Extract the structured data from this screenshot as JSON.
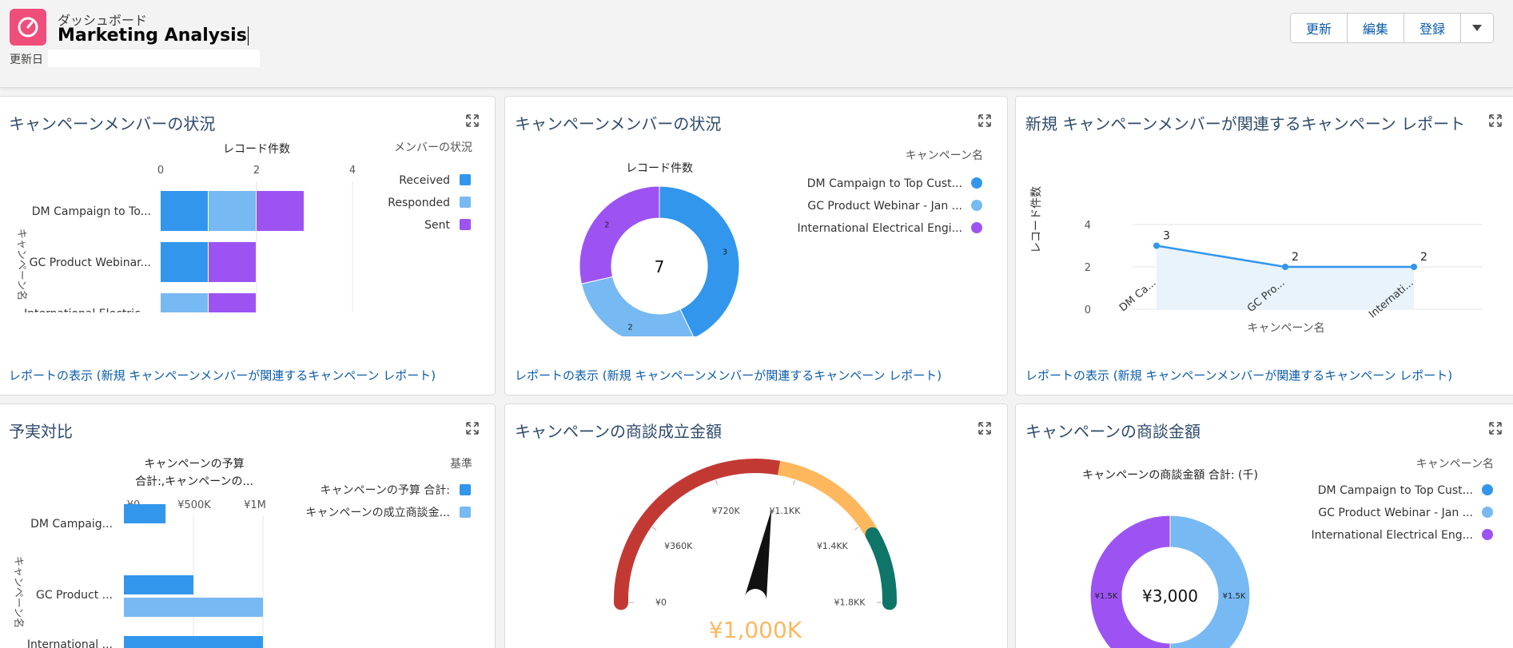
{
  "header": {
    "subtitle": "ダッシュボード",
    "title": "Marketing Analysis",
    "updated_label": "更新日",
    "buttons": {
      "refresh": "更新",
      "edit": "編集",
      "subscribe": "登録"
    }
  },
  "colors": {
    "blue": "#3296ed",
    "lightblue": "#77b9f2",
    "purple": "#9d53f2",
    "red": "#c23934",
    "orange": "#ffb75d",
    "teal": "#107569"
  },
  "widgets": {
    "status_bar": {
      "title": "キャンペーンメンバーの状況",
      "link": "レポートの表示 (新規 キャンペーンメンバーが関連するキャンペーン レポート)"
    },
    "status_donut": {
      "title": "キャンペーンメンバーの状況",
      "link": "レポートの表示 (新規 キャンペーンメンバーが関連するキャンペーン レポート)"
    },
    "line_report": {
      "title": "新規 キャンペーンメンバーが関連するキャンペーン レポート",
      "link": "レポートの表示 (新規 キャンペーンメンバーが関連するキャンペーン レポート)"
    },
    "budget_actual": {
      "title": "予実対比"
    },
    "won_amount": {
      "title": "キャンペーンの商談成立金額"
    },
    "opportunity_amount": {
      "title": "キャンペーンの商談金額"
    }
  },
  "chart_data": [
    {
      "type": "bar",
      "title": "レコード件数",
      "ylabel": "キャンペーン名",
      "legend_title": "メンバーの状況",
      "legend_position": "right",
      "categories": [
        "DM Campaign to To...",
        "GC Product Webinar...",
        "International Electric..."
      ],
      "series": [
        {
          "name": "Received",
          "values": [
            1,
            1,
            0
          ]
        },
        {
          "name": "Responded",
          "values": [
            1,
            0,
            1
          ]
        },
        {
          "name": "Sent",
          "values": [
            1,
            1,
            1
          ]
        }
      ],
      "xticks": [
        "0",
        "2",
        "4"
      ],
      "xlim": [
        0,
        4
      ]
    },
    {
      "type": "pie",
      "title": "レコード件数",
      "legend_title": "キャンペーン名",
      "center_label": "7",
      "categories": [
        "DM Campaign to Top Cust...",
        "GC Product Webinar - Jan ...",
        "International Electrical Engi..."
      ],
      "values": [
        3,
        2,
        2
      ]
    },
    {
      "type": "line",
      "ylabel": "レコード件数",
      "xlabel": "キャンペーン名",
      "categories": [
        "DM Ca...",
        "GC Pro...",
        "Internati..."
      ],
      "values": [
        3,
        2,
        2
      ],
      "yticks": [
        "4",
        "2",
        "0"
      ],
      "ylim": [
        0,
        4
      ]
    },
    {
      "type": "bar",
      "title": "キャンペーンの予算",
      "subtitle": "合計:,キャンペーンの...",
      "ylabel": "キャンペーン名",
      "legend_title": "基準",
      "categories": [
        "DM Campaig...",
        "GC Product ...",
        "International ..."
      ],
      "series": [
        {
          "name": "キャンペーンの予算 合計:",
          "values": [
            300,
            500,
            1000
          ]
        },
        {
          "name": "キャンペーンの成立商談金...",
          "values": [
            0,
            1000,
            0
          ]
        }
      ],
      "xticks": [
        "¥0",
        "¥500K",
        "¥1M"
      ],
      "xlim": [
        0,
        1000
      ]
    },
    {
      "type": "gauge",
      "value": 1000,
      "value_label": "¥1,000K",
      "min": 0,
      "max": 1800,
      "ticks": [
        "¥0",
        "¥360K",
        "¥720K",
        "¥1.1KK",
        "¥1.4KK",
        "¥1.8KK"
      ],
      "segments": [
        {
          "to": 1000,
          "color": "red"
        },
        {
          "to": 1500,
          "color": "orange"
        },
        {
          "to": 1800,
          "color": "teal"
        }
      ]
    },
    {
      "type": "pie",
      "title": "キャンペーンの商談金額 合計: (千)",
      "legend_title": "キャンペーン名",
      "center_label": "¥3,000",
      "categories": [
        "DM Campaign to Top Cust...",
        "GC Product Webinar - Jan ...",
        "International Electrical Eng..."
      ],
      "values": [
        0,
        1500,
        1500
      ],
      "slice_labels": [
        "",
        "¥1.5K",
        "¥1.5K"
      ]
    }
  ]
}
